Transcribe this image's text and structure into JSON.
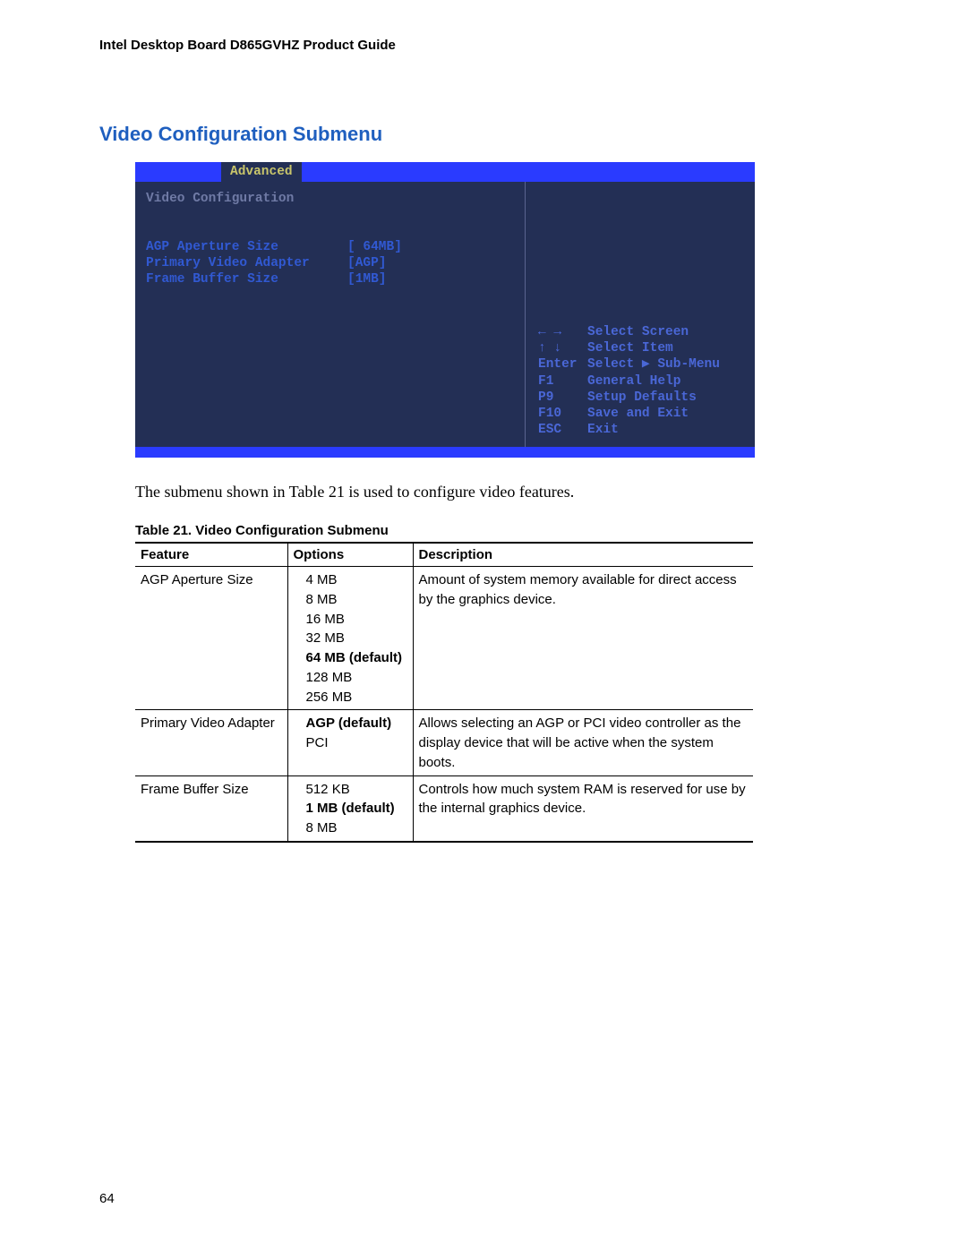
{
  "doc_header": "Intel Desktop Board D865GVHZ Product Guide",
  "section_title": "Video Configuration Submenu",
  "bios": {
    "tab_active": "Advanced",
    "subtitle": "Video Configuration",
    "settings": [
      {
        "label": "AGP Aperture Size",
        "value": "[ 64MB]"
      },
      {
        "label": "Primary Video Adapter",
        "value": "[AGP]"
      },
      {
        "label": "Frame Buffer Size",
        "value": "[1MB]"
      }
    ],
    "help": [
      {
        "key": "← →",
        "text": "Select Screen"
      },
      {
        "key": "↑ ↓",
        "text": "Select Item"
      },
      {
        "key": "Enter",
        "text": "Select ▶ Sub-Menu"
      },
      {
        "key": "F1",
        "text": "General Help"
      },
      {
        "key": "P9",
        "text": "Setup Defaults"
      },
      {
        "key": "F10",
        "text": "Save and Exit"
      },
      {
        "key": "ESC",
        "text": "Exit"
      }
    ]
  },
  "body_text": "The submenu shown in Table 21 is used to configure video features.",
  "table_caption": "Table 21.    Video Configuration Submenu",
  "table": {
    "headers": {
      "feature": "Feature",
      "options": "Options",
      "description": "Description"
    },
    "rows": [
      {
        "feature": "AGP Aperture Size",
        "options": [
          {
            "text": "4 MB",
            "bold": false
          },
          {
            "text": "8 MB",
            "bold": false
          },
          {
            "text": "16 MB",
            "bold": false
          },
          {
            "text": "32 MB",
            "bold": false
          },
          {
            "text": "64 MB (default)",
            "bold": true
          },
          {
            "text": "128 MB",
            "bold": false
          },
          {
            "text": "256 MB",
            "bold": false
          }
        ],
        "description": "Amount of system memory available for direct access by the graphics device."
      },
      {
        "feature": "Primary Video Adapter",
        "options": [
          {
            "text": "AGP (default)",
            "bold": true
          },
          {
            "text": "PCI",
            "bold": false
          }
        ],
        "description": "Allows selecting an AGP or PCI video controller as the display device that will be active when the system boots."
      },
      {
        "feature": "Frame Buffer Size",
        "options": [
          {
            "text": "512 KB",
            "bold": false
          },
          {
            "text": "1 MB (default)",
            "bold": true
          },
          {
            "text": "8 MB",
            "bold": false
          }
        ],
        "description": "Controls how much system RAM is reserved for use by the internal graphics device."
      }
    ]
  },
  "page_number": "64"
}
